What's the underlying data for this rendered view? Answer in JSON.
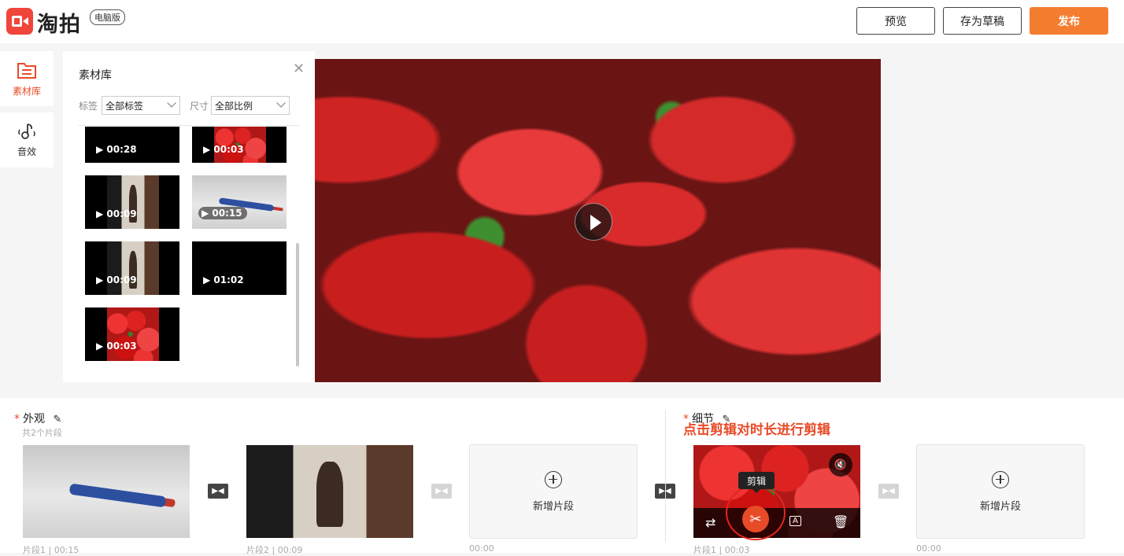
{
  "header": {
    "logo_text": "淘拍",
    "logo_badge": "电脑版",
    "preview_label": "预览",
    "draft_label": "存为草稿",
    "publish_label": "发布",
    "accent": "#f47d2f"
  },
  "rail": {
    "items": [
      {
        "label": "素材库",
        "icon": "library-icon",
        "active": true
      },
      {
        "label": "音效",
        "icon": "sound-effect-icon",
        "active": false
      }
    ]
  },
  "library": {
    "title": "素材库",
    "tag_label": "标签",
    "tag_value": "全部标签",
    "size_label": "尺寸",
    "size_value": "全部比例",
    "items": [
      {
        "duration": "▶ 00:28"
      },
      {
        "duration": "▶ 00:03"
      },
      {
        "duration": "▶ 00:09"
      },
      {
        "duration": "▶ 00:15"
      },
      {
        "duration": "▶ 00:09"
      },
      {
        "duration": "▶ 01:02"
      },
      {
        "duration": "▶ 00:03"
      }
    ]
  },
  "sections": {
    "appearance": {
      "title": "外观",
      "subtitle": "共2个片段",
      "clips": [
        {
          "caption": "片段1 | 00:15"
        },
        {
          "caption": "片段2 | 00:09"
        }
      ],
      "add_label": "新增片段",
      "add_caption": "00:00"
    },
    "detail": {
      "title": "细节",
      "clips": [
        {
          "caption": "片段1 | 00:03"
        }
      ],
      "add_label": "新增片段",
      "add_caption": "00:00",
      "tooltip": "剪辑",
      "annotation": "点击剪辑对时长进行剪辑"
    }
  }
}
